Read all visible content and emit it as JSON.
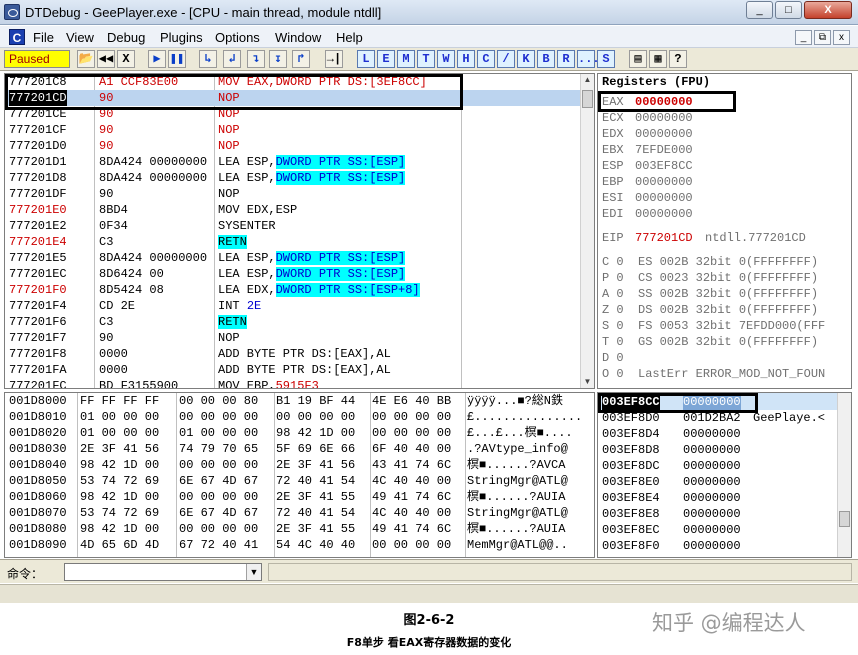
{
  "window": {
    "title": "DTDebug - GeePlayer.exe - [CPU - main thread, module ntdll]",
    "buttons": [
      "_",
      "□",
      "X"
    ]
  },
  "menu": [
    "C",
    "File",
    "View",
    "Debug",
    "Plugins",
    "Options",
    "Window",
    "Help"
  ],
  "mdi_buttons": [
    "_",
    "⧉",
    "x"
  ],
  "toolbar": {
    "status": "Paused",
    "buttons": [
      "📂",
      "◀◀",
      "X",
      "▶",
      "❚❚",
      "↳",
      "↲",
      "↴",
      "↧",
      "↱",
      "→|",
      "L",
      "E",
      "M",
      "T",
      "W",
      "H",
      "C",
      "/",
      "K",
      "B",
      "R",
      "...",
      "S",
      "▤",
      "▦",
      "?"
    ]
  },
  "cpu": {
    "rows": [
      {
        "addr": "777201C8",
        "hex": "A1 CCF83E00",
        "asm": "MOV EAX,DWORD PTR DS:[3EF8CC]",
        "addr_style": "normal",
        "asm_style": "red",
        "hex_style": "red"
      },
      {
        "addr": "777201CD",
        "hex": "90",
        "asm": "NOP",
        "addr_style": "sel",
        "asm_style": "red",
        "hex_style": "red",
        "row_hl": true
      },
      {
        "addr": "777201CE",
        "hex": "90",
        "asm": "NOP",
        "addr_style": "normal",
        "asm_style": "red",
        "hex_style": "red"
      },
      {
        "addr": "777201CF",
        "hex": "90",
        "asm": "NOP",
        "addr_style": "normal",
        "asm_style": "red",
        "hex_style": "red"
      },
      {
        "addr": "777201D0",
        "hex": "90",
        "asm": "NOP",
        "addr_style": "normal",
        "asm_style": "red",
        "hex_style": "red"
      },
      {
        "addr": "777201D1",
        "hex": "8DA424 00000000",
        "asm": "LEA ESP,",
        "asm2": "DWORD PTR SS:[ESP]",
        "addr_style": "normal"
      },
      {
        "addr": "777201D8",
        "hex": "8DA424 00000000",
        "asm": "LEA ESP,",
        "asm2": "DWORD PTR SS:[ESP]",
        "addr_style": "normal"
      },
      {
        "addr": "777201DF",
        "hex": "90",
        "asm": "NOP",
        "addr_style": "normal"
      },
      {
        "addr": "777201E0",
        "hex": "8BD4",
        "asm": "MOV EDX,ESP",
        "addr_style": "red"
      },
      {
        "addr": "777201E2",
        "hex": "0F34",
        "asm": "SYSENTER",
        "addr_style": "normal"
      },
      {
        "addr": "777201E4",
        "hex": "C3",
        "asm": "RETN",
        "addr_style": "red",
        "asm_style": "hl"
      },
      {
        "addr": "777201E5",
        "hex": "8DA424 00000000",
        "asm": "LEA ESP,",
        "asm2": "DWORD PTR SS:[ESP]",
        "addr_style": "normal"
      },
      {
        "addr": "777201EC",
        "hex": "8D6424 00",
        "asm": "LEA ESP,",
        "asm2": "DWORD PTR SS:[ESP]",
        "addr_style": "normal"
      },
      {
        "addr": "777201F0",
        "hex": "8D5424 08",
        "asm": "LEA EDX,",
        "asm2": "DWORD PTR SS:[ESP+8]",
        "addr_style": "red"
      },
      {
        "addr": "777201F4",
        "hex": "CD 2E",
        "asm": "INT ",
        "asm3": "2E",
        "addr_style": "normal"
      },
      {
        "addr": "777201F6",
        "hex": "C3",
        "asm": "RETN",
        "addr_style": "normal",
        "asm_style": "hl"
      },
      {
        "addr": "777201F7",
        "hex": "90",
        "asm": "NOP",
        "addr_style": "normal"
      },
      {
        "addr": "777201F8",
        "hex": "0000",
        "asm": "ADD BYTE PTR DS:[EAX],AL",
        "addr_style": "normal"
      },
      {
        "addr": "777201FA",
        "hex": "0000",
        "asm": "ADD BYTE PTR DS:[EAX],AL",
        "addr_style": "normal"
      },
      {
        "addr": "777201FC",
        "hex": "BD F3155900",
        "asm": "MOV EBP,",
        "asm3": "5915F3",
        "addr_style": "normal"
      }
    ]
  },
  "registers": {
    "title": "Registers (FPU)",
    "gp": [
      {
        "name": "EAX",
        "value": "00000000",
        "changed": true
      },
      {
        "name": "ECX",
        "value": "00000000"
      },
      {
        "name": "EDX",
        "value": "00000000"
      },
      {
        "name": "EBX",
        "value": "7EFDE000"
      },
      {
        "name": "ESP",
        "value": "003EF8CC"
      },
      {
        "name": "EBP",
        "value": "00000000"
      },
      {
        "name": "ESI",
        "value": "00000000"
      },
      {
        "name": "EDI",
        "value": "00000000"
      }
    ],
    "eip": {
      "name": "EIP",
      "value": "777201CD",
      "comment": "ntdll.777201CD"
    },
    "flags": [
      "C 0  ES 002B 32bit 0(FFFFFFFF)",
      "P 0  CS 0023 32bit 0(FFFFFFFF)",
      "A 0  SS 002B 32bit 0(FFFFFFFF)",
      "Z 0  DS 002B 32bit 0(FFFFFFFF)",
      "S 0  FS 0053 32bit 7EFDD000(FFF",
      "T 0  GS 002B 32bit 0(FFFFFFFF)",
      "D 0",
      "O 0  LastErr ERROR_MOD_NOT_FOUN"
    ]
  },
  "dump": {
    "rows": [
      {
        "addr": "001D8000",
        "b1": "FF FF FF FF",
        "b2": "00 00 00 80",
        "b3": "B1 19 BF 44",
        "b4": "4E E6 40 BB",
        "ascii": "ÿÿÿÿ...■?総N鉄"
      },
      {
        "addr": "001D8010",
        "b1": "01 00 00 00",
        "b2": "00 00 00 00",
        "b3": "00 00 00 00",
        "b4": "00 00 00 00",
        "ascii": "£..............."
      },
      {
        "addr": "001D8020",
        "b1": "01 00 00 00",
        "b2": "01 00 00 00",
        "b3": "98 42 1D 00",
        "b4": "00 00 00 00",
        "ascii": "£...£...榠■...."
      },
      {
        "addr": "001D8030",
        "b1": "2E 3F 41 56",
        "b2": "74 79 70 65",
        "b3": "5F 69 6E 66",
        "b4": "6F 40 40 00",
        "ascii": ".?AVtype_info@"
      },
      {
        "addr": "001D8040",
        "b1": "98 42 1D 00",
        "b2": "00 00 00 00",
        "b3": "2E 3F 41 56",
        "b4": "43 41 74 6C",
        "ascii": "榠■......?AVCA"
      },
      {
        "addr": "001D8050",
        "b1": "53 74 72 69",
        "b2": "6E 67 4D 67",
        "b3": "72 40 41 54",
        "b4": "4C 40 40 00",
        "ascii": "StringMgr@ATL@"
      },
      {
        "addr": "001D8060",
        "b1": "98 42 1D 00",
        "b2": "00 00 00 00",
        "b3": "2E 3F 41 55",
        "b4": "49 41 74 6C",
        "ascii": "榠■......?AUIA"
      },
      {
        "addr": "001D8070",
        "b1": "53 74 72 69",
        "b2": "6E 67 4D 67",
        "b3": "72 40 41 54",
        "b4": "4C 40 40 00",
        "ascii": "StringMgr@ATL@"
      },
      {
        "addr": "001D8080",
        "b1": "98 42 1D 00",
        "b2": "00 00 00 00",
        "b3": "2E 3F 41 55",
        "b4": "49 41 74 6C",
        "ascii": "榠■......?AUIA"
      },
      {
        "addr": "001D8090",
        "b1": "4D 65 6D 4D",
        "b2": "67 72 40 41",
        "b3": "54 4C 40 40",
        "b4": "00 00 00 00",
        "ascii": "MemMgr@ATL@@.."
      }
    ]
  },
  "stack": {
    "rows": [
      {
        "addr": "003EF8CC",
        "value": "00000000",
        "comment": "",
        "selected": true
      },
      {
        "addr": "003EF8D0",
        "value": "001D2BA2",
        "comment": "GeePlaye.<"
      },
      {
        "addr": "003EF8D4",
        "value": "00000000",
        "comment": ""
      },
      {
        "addr": "003EF8D8",
        "value": "00000000",
        "comment": ""
      },
      {
        "addr": "003EF8DC",
        "value": "00000000",
        "comment": ""
      },
      {
        "addr": "003EF8E0",
        "value": "00000000",
        "comment": ""
      },
      {
        "addr": "003EF8E4",
        "value": "00000000",
        "comment": ""
      },
      {
        "addr": "003EF8E8",
        "value": "00000000",
        "comment": ""
      },
      {
        "addr": "003EF8EC",
        "value": "00000000",
        "comment": ""
      },
      {
        "addr": "003EF8F0",
        "value": "00000000",
        "comment": ""
      }
    ]
  },
  "command": {
    "label": "命令：",
    "value": ""
  },
  "caption": {
    "figure": "图2-6-2",
    "text": "F8单步 看EAX寄存器数据的变化",
    "watermark": "知乎 @编程达人"
  }
}
